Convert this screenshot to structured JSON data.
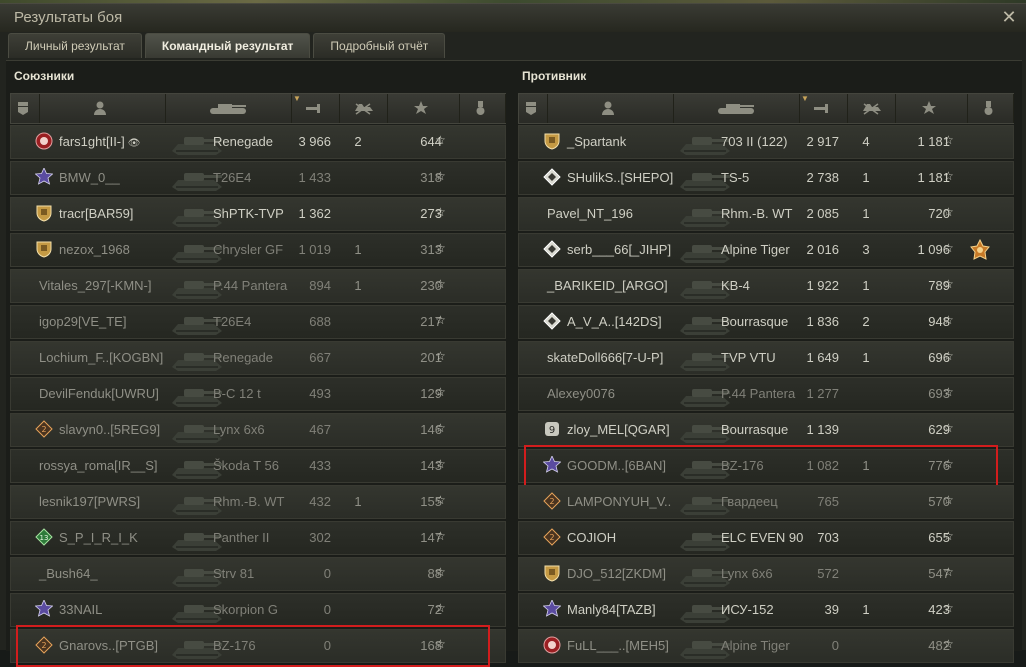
{
  "window": {
    "title": "Результаты боя"
  },
  "tabs": [
    {
      "label": "Личный результат"
    },
    {
      "label": "Командный результат"
    },
    {
      "label": "Подробный отчёт"
    }
  ],
  "allies": {
    "title": "Союзники",
    "rows": [
      {
        "name": "fars1ght[II-]",
        "tank": "Renegade",
        "damage": "3 966",
        "kills": "2",
        "xp": "644",
        "badge": "red",
        "dead": false,
        "hl": false
      },
      {
        "name": "BMW_0__",
        "tank": "T26E4",
        "damage": "1 433",
        "kills": "",
        "xp": "318",
        "badge": "purple",
        "dead": true,
        "hl": false
      },
      {
        "name": "tracr[BAR59]",
        "tank": "ShPTK-TVP",
        "damage": "1 362",
        "kills": "",
        "xp": "273",
        "badge": "gold",
        "dead": false,
        "hl": false
      },
      {
        "name": "nezox_1968",
        "tank": "Chrysler GF",
        "damage": "1 019",
        "kills": "1",
        "xp": "313",
        "badge": "gold",
        "dead": true,
        "hl": false
      },
      {
        "name": "Vitales_297[-KMN-]",
        "tank": "P.44 Pantera",
        "damage": "894",
        "kills": "1",
        "xp": "230",
        "badge": "",
        "dead": true,
        "hl": false
      },
      {
        "name": "igop29[VE_TE]",
        "tank": "T26E4",
        "damage": "688",
        "kills": "",
        "xp": "217",
        "badge": "",
        "dead": true,
        "hl": false
      },
      {
        "name": "Lochium_F..[KOGBN]",
        "tank": "Renegade",
        "damage": "667",
        "kills": "",
        "xp": "201",
        "badge": "",
        "dead": true,
        "hl": false
      },
      {
        "name": "DevilFenduk[UWRU]",
        "tank": "B-C 12 t",
        "damage": "493",
        "kills": "",
        "xp": "129",
        "badge": "",
        "dead": true,
        "hl": false
      },
      {
        "name": "slavyn0..[5REG9]",
        "tank": "Lynx 6x6",
        "damage": "467",
        "kills": "",
        "xp": "146",
        "badge": "orange",
        "dead": true,
        "hl": false
      },
      {
        "name": "rossya_roma[IR__S]",
        "tank": "Škoda T 56",
        "damage": "433",
        "kills": "",
        "xp": "143",
        "badge": "",
        "dead": true,
        "hl": false
      },
      {
        "name": "lesnik197[PWRS]",
        "tank": "Rhm.-B. WT",
        "damage": "432",
        "kills": "1",
        "xp": "155",
        "badge": "",
        "dead": true,
        "hl": false
      },
      {
        "name": "S_P_I_R_I_K",
        "tank": "Panther II",
        "damage": "302",
        "kills": "",
        "xp": "147",
        "badge": "green",
        "dead": true,
        "hl": false
      },
      {
        "name": "_Bush64_",
        "tank": "Strv 81",
        "damage": "0",
        "kills": "",
        "xp": "88",
        "badge": "",
        "dead": true,
        "hl": false
      },
      {
        "name": "33NAIL",
        "tank": "Skorpion G",
        "damage": "0",
        "kills": "",
        "xp": "72",
        "badge": "purple",
        "dead": true,
        "hl": false
      },
      {
        "name": "Gnarovs..[PTGB]",
        "tank": "BZ-176",
        "damage": "0",
        "kills": "",
        "xp": "168",
        "badge": "orange",
        "dead": true,
        "hl": true
      }
    ]
  },
  "enemies": {
    "title": "Противник",
    "rows": [
      {
        "name": "_Spartank",
        "tank": "703 II (122)",
        "damage": "2 917",
        "kills": "4",
        "xp": "1 181",
        "badge": "gold",
        "dead": false,
        "hl": false,
        "medal": false
      },
      {
        "name": "SHulikS..[SHEPO]",
        "tank": "TS-5",
        "damage": "2 738",
        "kills": "1",
        "xp": "1 181",
        "badge": "white",
        "dead": false,
        "hl": false,
        "medal": false
      },
      {
        "name": "Pavel_NT_196",
        "tank": "Rhm.-B. WT",
        "damage": "2 085",
        "kills": "1",
        "xp": "720",
        "badge": "",
        "dead": false,
        "hl": false,
        "medal": false
      },
      {
        "name": "serb___66[_JIHP]",
        "tank": "Alpine Tiger",
        "damage": "2 016",
        "kills": "3",
        "xp": "1 096",
        "badge": "white",
        "dead": false,
        "hl": false,
        "medal": true
      },
      {
        "name": "_BARIKEID_[ARGO]",
        "tank": "KB-4",
        "damage": "1 922",
        "kills": "1",
        "xp": "789",
        "badge": "",
        "dead": false,
        "hl": false,
        "medal": false
      },
      {
        "name": "A_V_A..[142DS]",
        "tank": "Bourrasque",
        "damage": "1 836",
        "kills": "2",
        "xp": "948",
        "badge": "white",
        "dead": false,
        "hl": false,
        "medal": false
      },
      {
        "name": "skateDoll666[7-U-P]",
        "tank": "TVP VTU",
        "damage": "1 649",
        "kills": "1",
        "xp": "696",
        "badge": "",
        "dead": false,
        "hl": false,
        "medal": false
      },
      {
        "name": "Alexey0076",
        "tank": "P.44 Pantera",
        "damage": "1 277",
        "kills": "",
        "xp": "693",
        "badge": "",
        "dead": true,
        "hl": false,
        "medal": false
      },
      {
        "name": "zloy_MEL[QGAR]",
        "tank": "Bourrasque",
        "damage": "1 139",
        "kills": "",
        "xp": "629",
        "badge": "nine",
        "dead": false,
        "hl": false,
        "medal": false
      },
      {
        "name": "GOODM..[6BAN]",
        "tank": "BZ-176",
        "damage": "1 082",
        "kills": "1",
        "xp": "776",
        "badge": "purple",
        "dead": true,
        "hl": true,
        "medal": false
      },
      {
        "name": "LAMPONYUH_V..",
        "tank": "Гвардеец",
        "damage": "765",
        "kills": "",
        "xp": "570",
        "badge": "orange",
        "dead": true,
        "hl": false,
        "medal": false
      },
      {
        "name": "COJIOH",
        "tank": "ELC EVEN 90",
        "damage": "703",
        "kills": "",
        "xp": "655",
        "badge": "orange",
        "dead": false,
        "hl": false,
        "medal": false
      },
      {
        "name": "DJO_512[ZKDM]",
        "tank": "Lynx 6x6",
        "damage": "572",
        "kills": "",
        "xp": "547",
        "badge": "gold",
        "dead": true,
        "hl": false,
        "medal": false
      },
      {
        "name": "Manly84[TAZB]",
        "tank": "ИСУ-152",
        "damage": "39",
        "kills": "1",
        "xp": "423",
        "badge": "purple",
        "dead": false,
        "hl": false,
        "medal": false
      },
      {
        "name": "FuLL___..[MEH5]",
        "tank": "Alpine Tiger",
        "damage": "0",
        "kills": "",
        "xp": "482",
        "badge": "red",
        "dead": true,
        "hl": false,
        "medal": false
      }
    ]
  }
}
